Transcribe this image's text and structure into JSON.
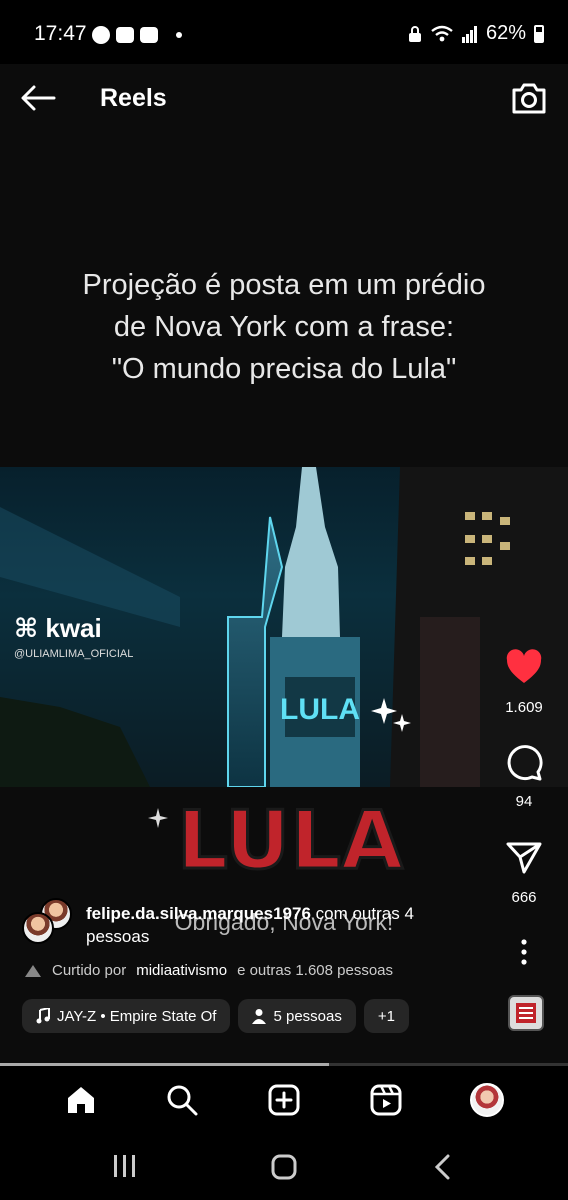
{
  "status": {
    "time": "17:47",
    "battery": "62%"
  },
  "header": {
    "title": "Reels"
  },
  "video": {
    "headline": [
      "Projeção é posta em um prédio",
      "de Nova York com a frase:",
      "\"O mundo precisa do Lula\""
    ],
    "watermark": "kwai",
    "watermark_handle": "@ULIAMLIMA_OFICIAL",
    "projection_text": "LULA",
    "big_text": "LULA",
    "caption": "Obrigado, Nova York!"
  },
  "actions": {
    "likes": "1.609",
    "comments": "94",
    "shares": "666"
  },
  "post": {
    "author": "felipe.da.silva.marques1976",
    "collab_text": "com outras 4 pessoas",
    "liked_prefix": "Curtido por",
    "liked_user": "midiaativismo",
    "liked_suffix": "e outras 1.608 pessoas"
  },
  "chips": {
    "audio": "JAY-Z • Empire State Of",
    "people": "5 pessoas",
    "more": "+1"
  },
  "progress": 0.58,
  "colors": {
    "like": "#ff3040",
    "accent_cyan": "#39d0e8",
    "lula_red": "#c0242b"
  }
}
